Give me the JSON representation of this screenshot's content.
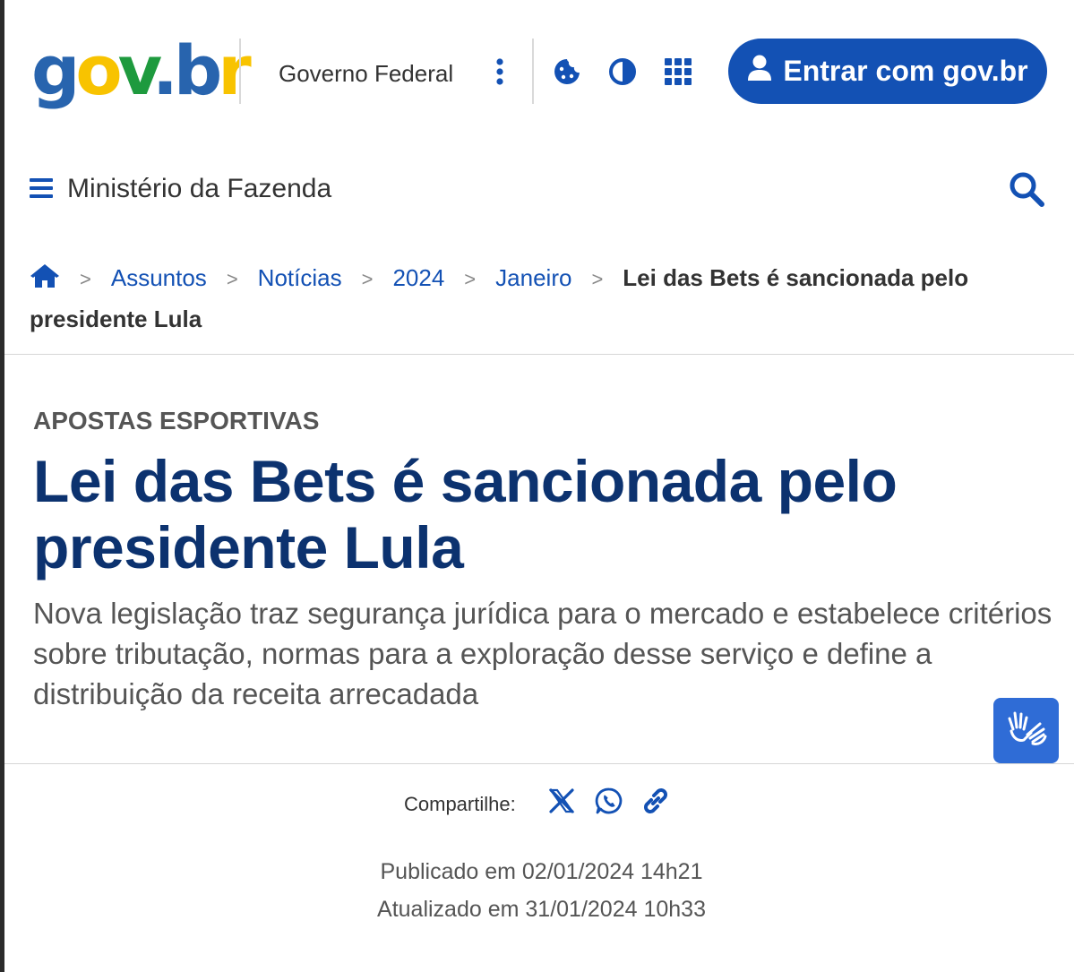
{
  "header": {
    "logo": {
      "g": "g",
      "o": "o",
      "v": "v",
      "dot": ".",
      "b": "b",
      "r": "r"
    },
    "gov_federal": "Governo Federal",
    "login_button": "Entrar com gov.br",
    "icons": [
      "more-vertical-icon",
      "cookie-icon",
      "contrast-icon",
      "apps-grid-icon",
      "user-icon"
    ]
  },
  "nav": {
    "ministry": "Ministério da Fazenda",
    "icons": [
      "menu-icon",
      "search-icon"
    ]
  },
  "breadcrumb": {
    "separator": ">",
    "links": [
      "Assuntos",
      "Notícias",
      "2024",
      "Janeiro"
    ],
    "current": "Lei das Bets é sancionada pelo presidente Lula"
  },
  "article": {
    "kicker": "APOSTAS ESPORTIVAS",
    "title": "Lei das Bets é sancionada pelo presidente Lula",
    "subtitle": "Nova legislação traz segurança jurídica para o mercado e estabelece critérios sobre tributação, normas para a exploração desse serviço e define a distribuição da receita arrecadada"
  },
  "share": {
    "label": "Compartilhe:",
    "icons": [
      "x-icon",
      "whatsapp-icon",
      "link-icon"
    ]
  },
  "dates": {
    "published": "Publicado em 02/01/2024 14h21",
    "updated": "Atualizado em 31/01/2024 10h33"
  },
  "colors": {
    "primary_blue": "#1351b4",
    "headline_blue": "#0c326f",
    "vlibras_blue": "#2f6cd6",
    "logo_blue": "#2864ae",
    "logo_yellow": "#f8c300",
    "logo_green": "#1e9a3e"
  }
}
